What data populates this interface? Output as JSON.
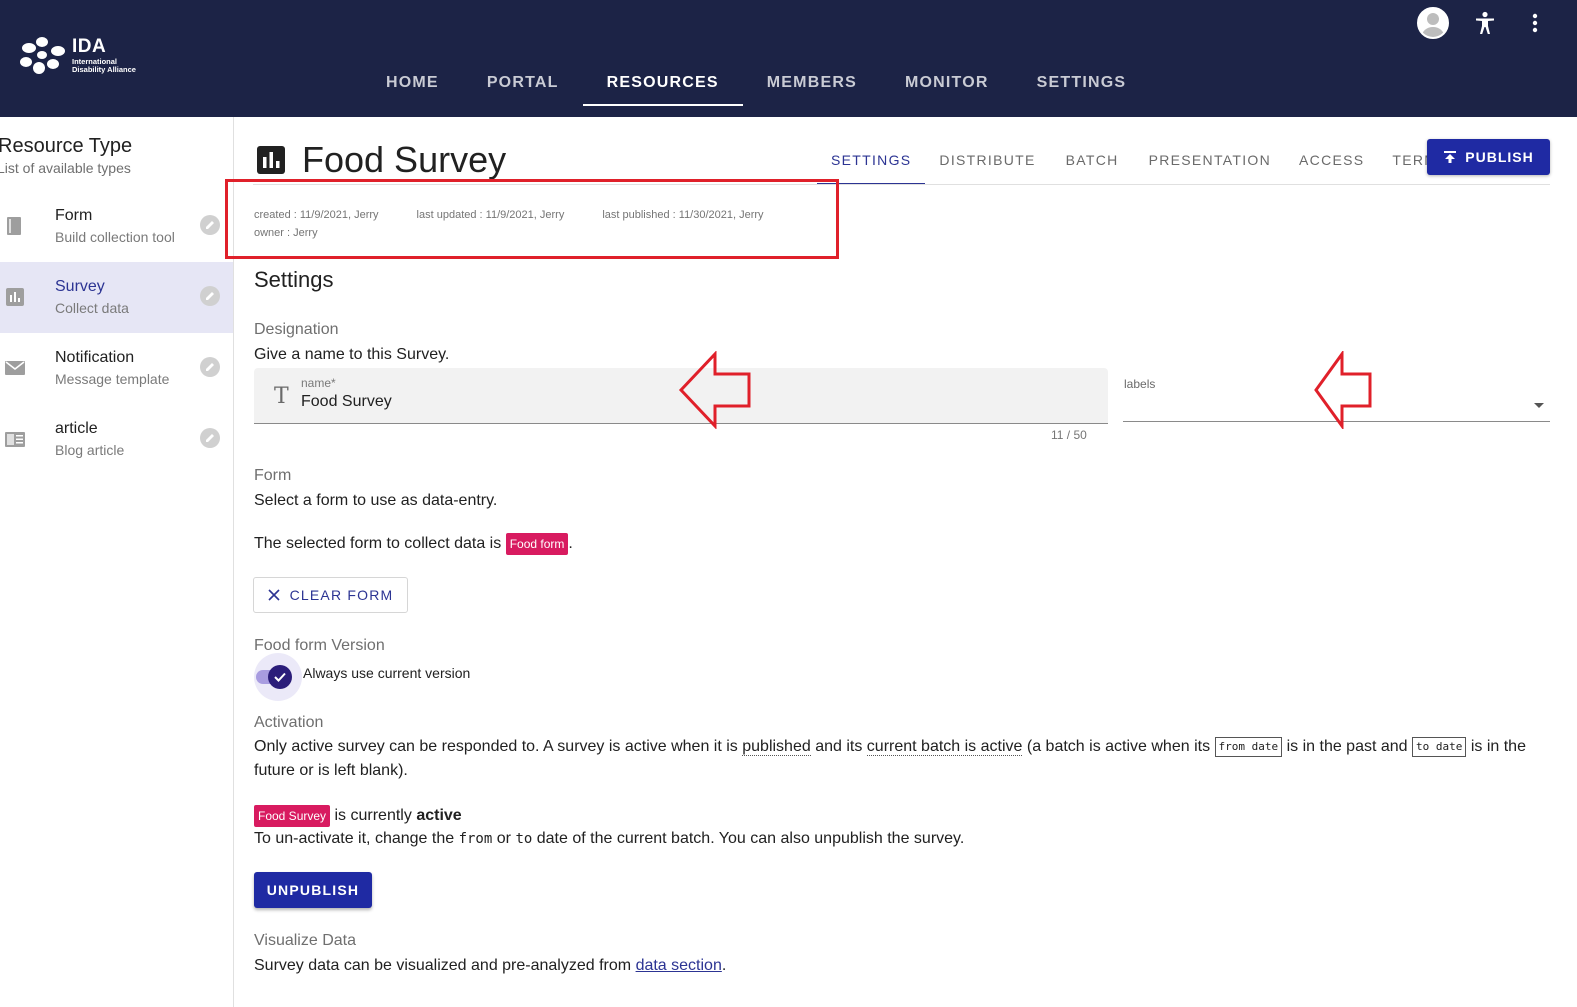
{
  "brand": {
    "title": "IDA",
    "subtitle_line1": "International",
    "subtitle_line2": "Disability Alliance"
  },
  "nav": [
    "HOME",
    "PORTAL",
    "RESOURCES",
    "MEMBERS",
    "MONITOR",
    "SETTINGS"
  ],
  "nav_active": "RESOURCES",
  "sidebar": {
    "title": "Resource Type",
    "subtitle": "List of available types",
    "items": [
      {
        "label": "Form",
        "desc": "Build collection tool",
        "icon": "form-icon"
      },
      {
        "label": "Survey",
        "desc": "Collect data",
        "icon": "survey-chart-icon",
        "active": true
      },
      {
        "label": "Notification",
        "desc": "Message template",
        "icon": "envelope-icon"
      },
      {
        "label": "article",
        "desc": "Blog article",
        "icon": "article-icon"
      }
    ]
  },
  "header": {
    "title": "Food Survey",
    "tabs": [
      "SETTINGS",
      "DISTRIBUTE",
      "BATCH",
      "PRESENTATION",
      "ACCESS",
      "TERMS"
    ],
    "active_tab": "SETTINGS",
    "publish_label": "PUBLISH"
  },
  "meta": {
    "created": "created : 11/9/2021, Jerry",
    "last_updated": "last updated : 11/9/2021, Jerry",
    "last_published": "last published : 11/30/2021, Jerry",
    "owner": "owner : Jerry"
  },
  "settings": {
    "heading": "Settings",
    "designation": {
      "label": "Designation",
      "help": "Give a name to this Survey.",
      "name_label": "name*",
      "name_value": "Food Survey",
      "counter": "11 / 50",
      "labels_label": "labels"
    },
    "form": {
      "label": "Form",
      "help": "Select a form to use as data-entry.",
      "selected_prefix": "The selected form to collect data is",
      "selected_chip": "Food form",
      "selected_suffix": ".",
      "clear_label": "CLEAR FORM"
    },
    "version": {
      "label": "Food form Version",
      "toggle_label": "Always use current version",
      "toggle_on": true
    },
    "activation": {
      "label": "Activation",
      "p1": "Only active survey can be responded to. A survey is active when it is",
      "published": "published",
      "and_its": "and its",
      "current_batch": "current batch is active",
      "p2": "(a batch is active when its",
      "from_date": "from date",
      "p3": "is in the past and",
      "to_date": "to date",
      "p4": "is in the",
      "p5": "future or is left blank).",
      "chip": "Food Survey",
      "is_currently": "is currently",
      "state": "active",
      "unactivate_1": "To un-activate it, change the",
      "from": "from",
      "or": "or",
      "to": "to",
      "unactivate_2": "date of the current batch. You can also unpublish the survey.",
      "unpublish_label": "UNPUBLISH"
    },
    "visualize": {
      "label": "Visualize Data",
      "text": "Survey data can be visualized and pre-analyzed from",
      "link": "data section",
      "suffix": "."
    }
  },
  "colors": {
    "topbar": "#1c2346",
    "accent": "#1f2aa3",
    "chip": "#d81b60",
    "annotation": "#e0202a"
  }
}
